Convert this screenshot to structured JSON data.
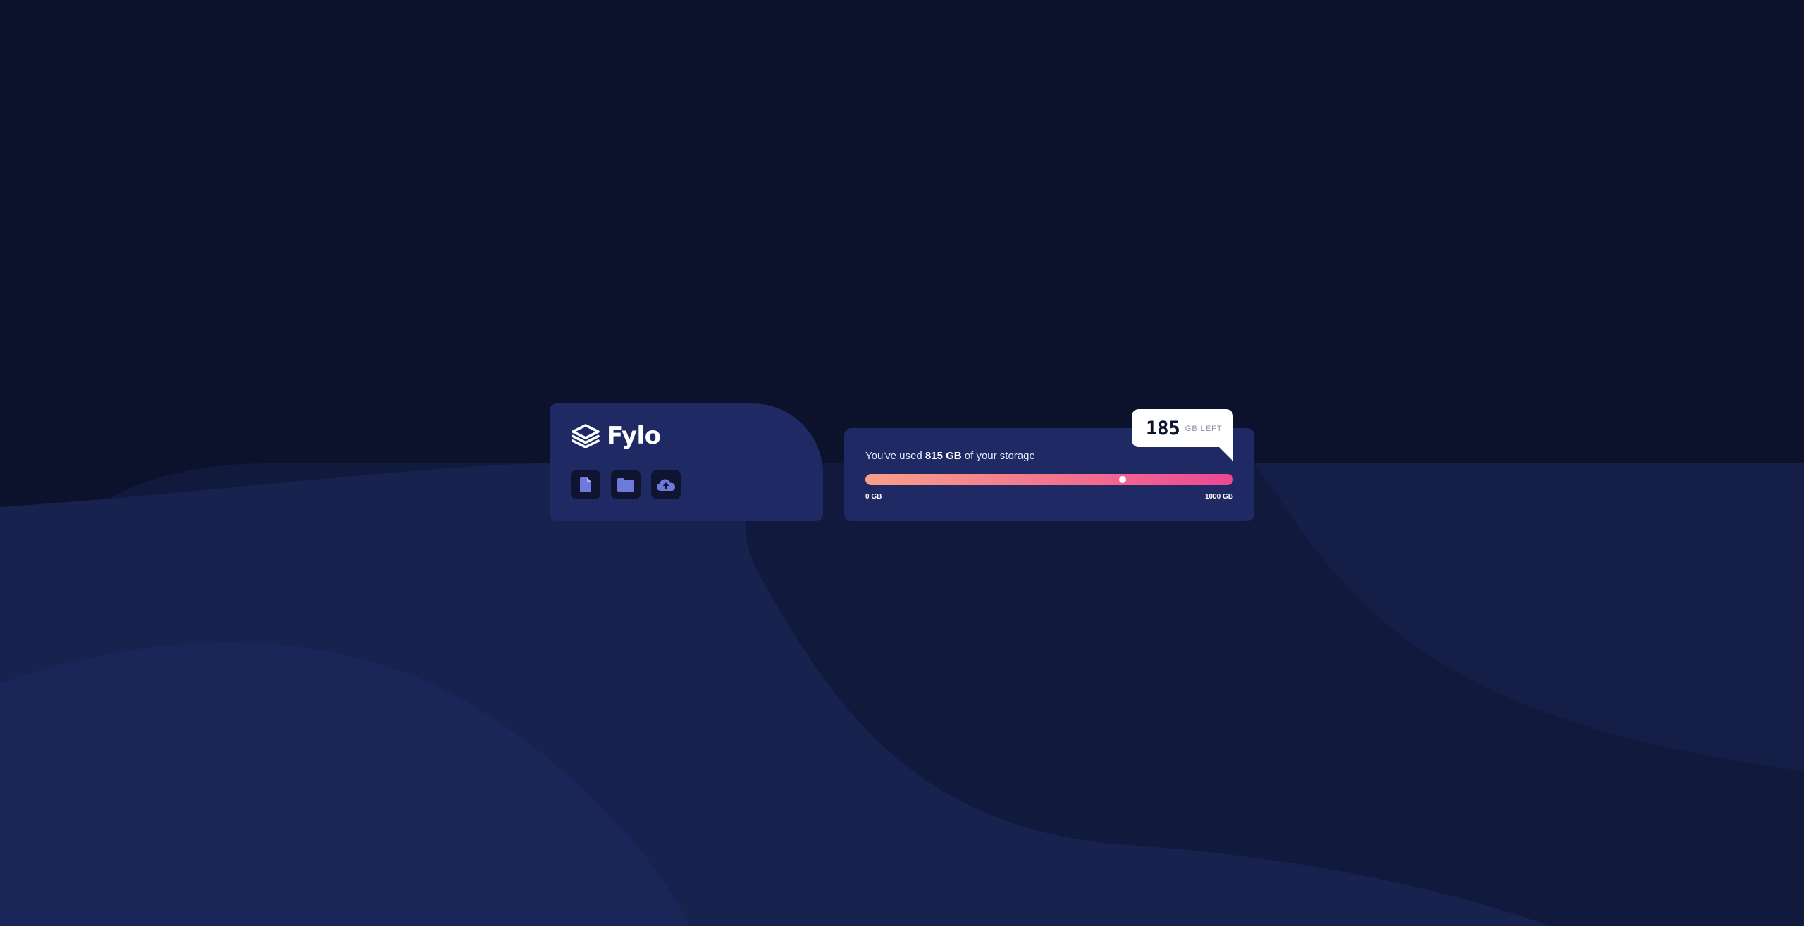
{
  "brand": {
    "name": "Fylo",
    "logo_icon": "layers-icon"
  },
  "toolbar": {
    "buttons": [
      {
        "icon": "file-icon"
      },
      {
        "icon": "folder-icon"
      },
      {
        "icon": "cloud-upload-icon"
      }
    ]
  },
  "storage": {
    "prefix": "You've used",
    "used_amount": "815 GB",
    "suffix": "of your storage",
    "used_fraction": 0.815,
    "min_label": "0 GB",
    "max_label": "1000 GB",
    "remaining_value": "185",
    "remaining_unit": "GB LEFT"
  },
  "colors": {
    "background": "#0c122c",
    "card": "#1f2a64",
    "icon_bg": "#0f1530",
    "icon_fill": "#6e79dc",
    "gradient_start": "#f8a08a",
    "gradient_end": "#ec4795",
    "text": "#ffffff"
  }
}
